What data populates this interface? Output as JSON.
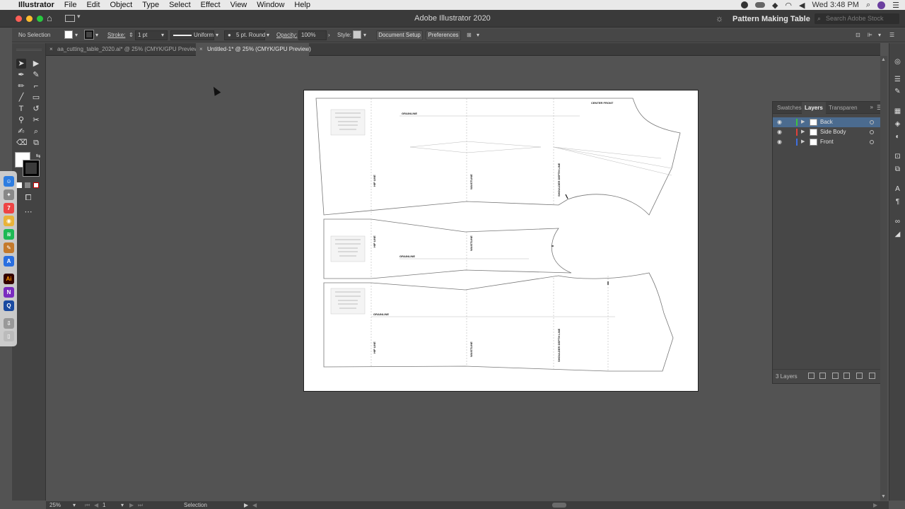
{
  "menubar": {
    "app_name": "Illustrator",
    "items": [
      "File",
      "Edit",
      "Object",
      "Type",
      "Select",
      "Effect",
      "View",
      "Window",
      "Help"
    ],
    "clock": "Wed 3:48 PM"
  },
  "titlebar": {
    "title": "Adobe Illustrator 2020",
    "workspace": "Pattern Making Table",
    "search_placeholder": "Search Adobe Stock"
  },
  "controlbar": {
    "selection": "No Selection",
    "stroke_label": "Stroke:",
    "stroke_weight": "1 pt",
    "profile": "Uniform",
    "brush": "5 pt. Round",
    "opacity_label": "Opacity:",
    "opacity": "100%",
    "style_label": "Style:",
    "document_setup": "Document Setup",
    "preferences": "Preferences"
  },
  "tabs": [
    {
      "label": "aa_cutting_table_2020.ai* @ 25% (CMYK/GPU Preview)",
      "active": false
    },
    {
      "label": "Untitled-1* @ 25% (CMYK/GPU Preview)",
      "active": true
    }
  ],
  "artboard": {
    "center_front": "CENTER FRONT",
    "grainline": "GRAINLINE",
    "line_labels": [
      "HIP LINE",
      "WAISTLINE",
      "SHOULDER DEPTH LINE",
      "HIP LINE",
      "WAISTLINE",
      "HIP LINE",
      "WAISTLINE",
      "SHOULDER DEPTH LINE"
    ]
  },
  "layers_panel": {
    "tabs": [
      "Swatches",
      "Layers",
      "Transparen"
    ],
    "active_tab": "Layers",
    "layers": [
      {
        "name": "Back",
        "color": "#3fc23f",
        "selected": true
      },
      {
        "name": "Side Body",
        "color": "#e0403a",
        "selected": false
      },
      {
        "name": "Front",
        "color": "#3f6fe0",
        "selected": false
      }
    ],
    "count": "3 Layers"
  },
  "statusbar": {
    "zoom": "25%",
    "artboard_number": "1",
    "tool": "Selection"
  },
  "colors": {
    "ui_bg": "#535353",
    "panel": "#474747",
    "selection_row": "#4b6b8f"
  }
}
